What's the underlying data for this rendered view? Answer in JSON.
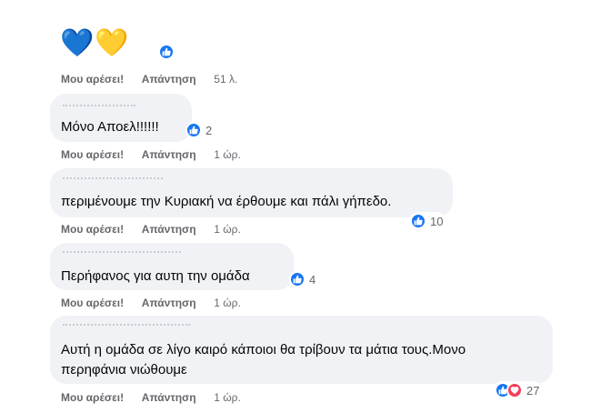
{
  "comments": [
    {
      "emoji": [
        "💙",
        "💛"
      ],
      "text": "",
      "reactions": {
        "icons": [
          "like-icon"
        ],
        "count": ""
      },
      "actions": {
        "like": "Μου αρέσει!",
        "reply": "Απάντηση",
        "time": "51 λ."
      }
    },
    {
      "text": "Μόνο Αποελ!!!!!!",
      "reactions": {
        "icons": [
          "like-icon"
        ],
        "count": "2"
      },
      "actions": {
        "like": "Μου αρέσει!",
        "reply": "Απάντηση",
        "time": "1 ώρ."
      }
    },
    {
      "text": "περιμένουμε την Κυριακή να έρθουμε και πάλι γήπεδο.",
      "reactions": {
        "icons": [
          "like-icon"
        ],
        "count": "10"
      },
      "actions": {
        "like": "Μου αρέσει!",
        "reply": "Απάντηση",
        "time": "1 ώρ."
      }
    },
    {
      "text": "Περήφανος για αυτη την ομάδα",
      "reactions": {
        "icons": [
          "like-icon"
        ],
        "count": "4"
      },
      "actions": {
        "like": "Μου αρέσει!",
        "reply": "Απάντηση",
        "time": "1 ώρ."
      }
    },
    {
      "text_line1": "Αυτή η ομάδα σε λίγο καιρό κάποιοι θα τρίβουν τα μάτια τους.Μονο",
      "text_line2": "περηφάνια νιώθουμε",
      "reactions": {
        "icons": [
          "like-icon",
          "heart-icon"
        ],
        "count": "27"
      },
      "actions": {
        "like": "Μου αρέσει!",
        "reply": "Απάντηση",
        "time": "1 ώρ."
      }
    }
  ],
  "colors": {
    "like": "#1877f2",
    "love": "#f33e58",
    "bubble": "#f0f2f5",
    "meta": "#65676b"
  }
}
